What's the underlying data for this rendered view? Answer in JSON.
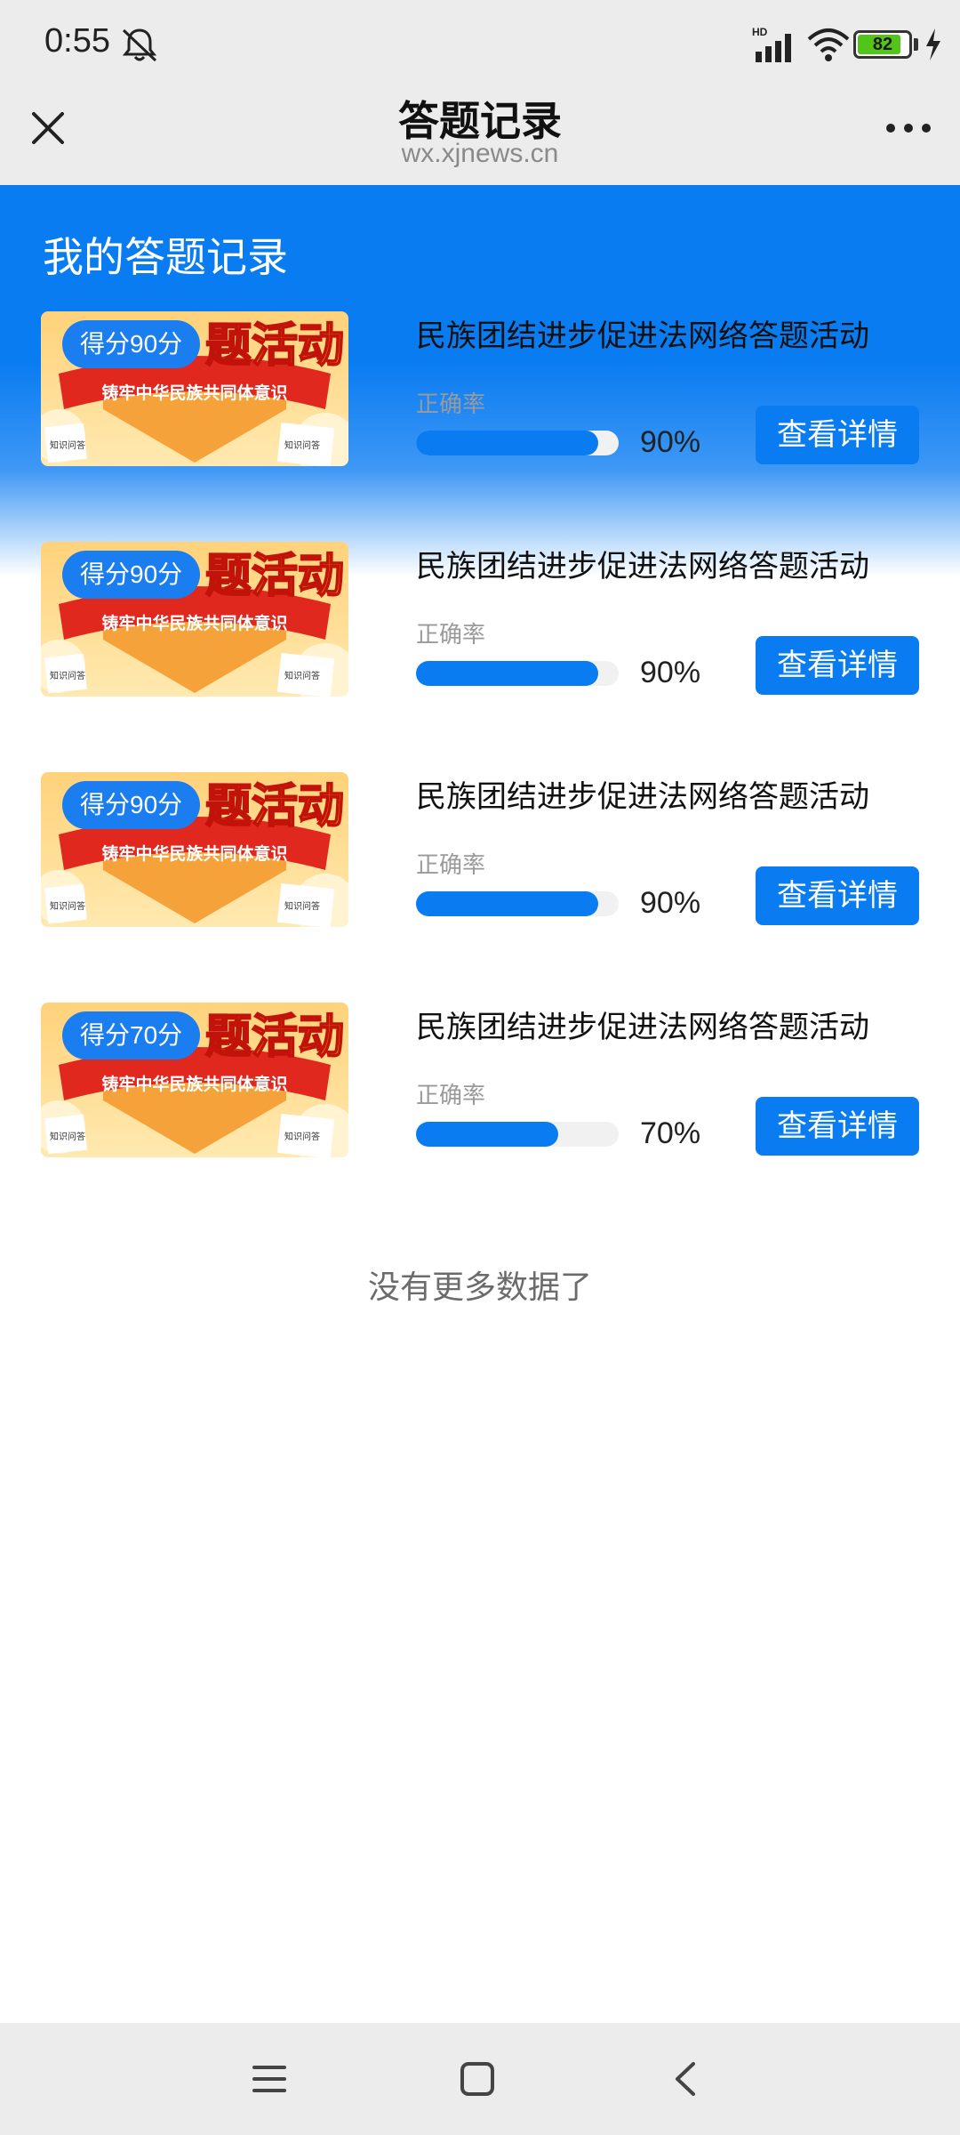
{
  "status_bar": {
    "time": "0:55",
    "signal_label": "HD",
    "battery_level": "82",
    "icons": [
      "bell-off-icon",
      "signal-icon",
      "wifi-icon",
      "battery-icon",
      "charging-icon"
    ]
  },
  "nav": {
    "title": "答题记录",
    "url": "wx.xjnews.cn",
    "icons": [
      "close-icon",
      "more-icon"
    ]
  },
  "page": {
    "section_title": "我的答题记录",
    "end_text": "没有更多数据了"
  },
  "banner": {
    "headline": "题活动",
    "ribbon": "铸牢中华民族共同体意识",
    "tag_left": "知识问答",
    "tag_right": "知识问答"
  },
  "records": [
    {
      "score": "得分90分",
      "title": "民族团结进步促进法网络答题活动",
      "accuracy_label": "正确率",
      "accuracy": "90%",
      "accuracy_fraction": 0.9,
      "button": "查看详情"
    },
    {
      "score": "得分90分",
      "title": "民族团结进步促进法网络答题活动",
      "accuracy_label": "正确率",
      "accuracy": "90%",
      "accuracy_fraction": 0.9,
      "button": "查看详情"
    },
    {
      "score": "得分90分",
      "title": "民族团结进步促进法网络答题活动",
      "accuracy_label": "正确率",
      "accuracy": "90%",
      "accuracy_fraction": 0.9,
      "button": "查看详情"
    },
    {
      "score": "得分70分",
      "title": "民族团结进步促进法网络答题活动",
      "accuracy_label": "正确率",
      "accuracy": "70%",
      "accuracy_fraction": 0.7,
      "button": "查看详情"
    }
  ],
  "system_nav": {
    "icons": [
      "menu-icon",
      "home-icon",
      "back-icon"
    ]
  },
  "colors": {
    "primary": "#0a7cf2",
    "background": "#ffffff",
    "bar_bg": "#ececec"
  }
}
